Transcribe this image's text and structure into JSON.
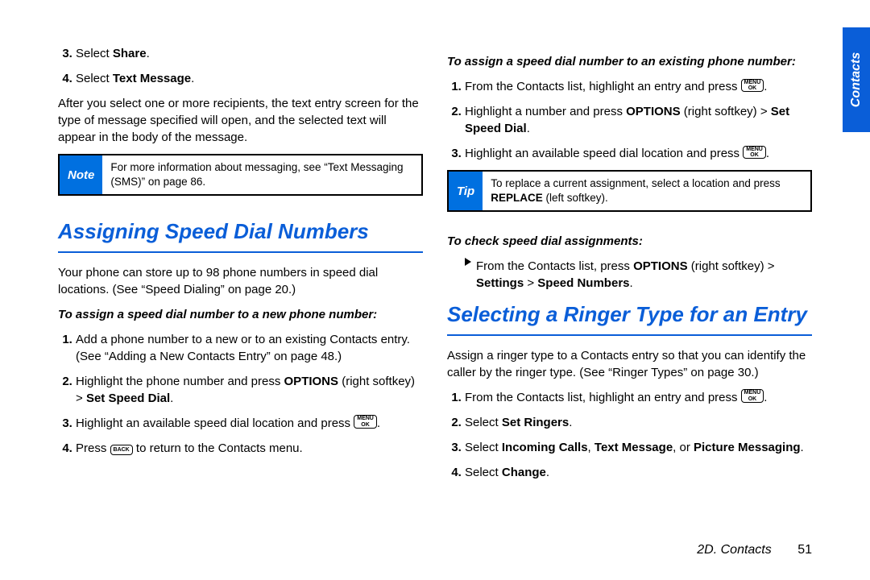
{
  "side_tab": "Contacts",
  "footer": {
    "section": "2D. Contacts",
    "page": "51"
  },
  "keys": {
    "menu_ok": {
      "line1": "MENU",
      "line2": "OK"
    },
    "back": "BACK"
  },
  "left": {
    "initial_steps": [
      {
        "n": "3.",
        "pre": "Select ",
        "bold": "Share",
        "post": "."
      },
      {
        "n": "4.",
        "pre": "Select ",
        "bold": "Text Message",
        "post": "."
      }
    ],
    "paragraph_after_initial": "After you select one or more recipients, the text entry screen for the type of message specified will open, and the selected text will appear in the body of the message.",
    "note": {
      "label": "Note",
      "text": "For more information about messaging, see “Text Messaging (SMS)” on page 86."
    },
    "heading": "Assigning Speed Dial Numbers",
    "intro": "Your phone can store up to 98 phone numbers in speed dial locations. (See “Speed Dialing” on page 20.)",
    "sub1": "To assign a speed dial number to a new phone number:",
    "list1": {
      "s1": "Add a phone number to a new or to an existing Contacts entry. (See “Adding a New Contacts Entry” on page 48.)",
      "s2_pre": "Highlight the phone number and press ",
      "s2_b1": "OPTIONS",
      "s2_mid": " (right softkey) > ",
      "s2_b2": "Set Speed Dial",
      "s2_post": ".",
      "s3_pre": "Highlight an available speed dial location and press ",
      "s3_post": ".",
      "s4_pre": "Press ",
      "s4_post": " to return to the Contacts menu."
    }
  },
  "right": {
    "sub_existing": "To assign a speed dial number to an existing phone number:",
    "list_exist": {
      "s1_pre": "From the Contacts list, highlight an entry and press ",
      "s1_post": ".",
      "s2_pre": "Highlight a number and press ",
      "s2_b1": "OPTIONS",
      "s2_mid": " (right softkey) > ",
      "s2_b2": "Set Speed Dial",
      "s2_post": ".",
      "s3_pre": "Highlight an available speed dial location and press ",
      "s3_post": "."
    },
    "tip": {
      "label": "Tip",
      "text_pre": "To replace a current assignment, select a location and press ",
      "text_b": "REPLACE",
      "text_post": " (left softkey)."
    },
    "sub_check": "To check speed dial assignments:",
    "check_pre": "From the Contacts list, press ",
    "check_b1": "OPTIONS",
    "check_mid": " (right softkey) > ",
    "check_b2": "Settings",
    "check_gt": " > ",
    "check_b3": "Speed Numbers",
    "check_post": ".",
    "heading2": "Selecting a Ringer Type for an Entry",
    "intro2": "Assign a ringer type to a Contacts entry so that you can identify the caller by the ringer type. (See “Ringer Types” on page 30.)",
    "list2": {
      "s1_pre": "From the Contacts list, highlight an entry and press ",
      "s1_post": ".",
      "s2_pre": "Select ",
      "s2_b": "Set Ringers",
      "s2_post": ".",
      "s3_pre": "Select ",
      "s3_b1": "Incoming Calls",
      "s3_c1": ", ",
      "s3_b2": "Text Message",
      "s3_c2": ", or ",
      "s3_b3": "Picture Messaging",
      "s3_post": ".",
      "s4_pre": "Select ",
      "s4_b": "Change",
      "s4_post": "."
    }
  }
}
